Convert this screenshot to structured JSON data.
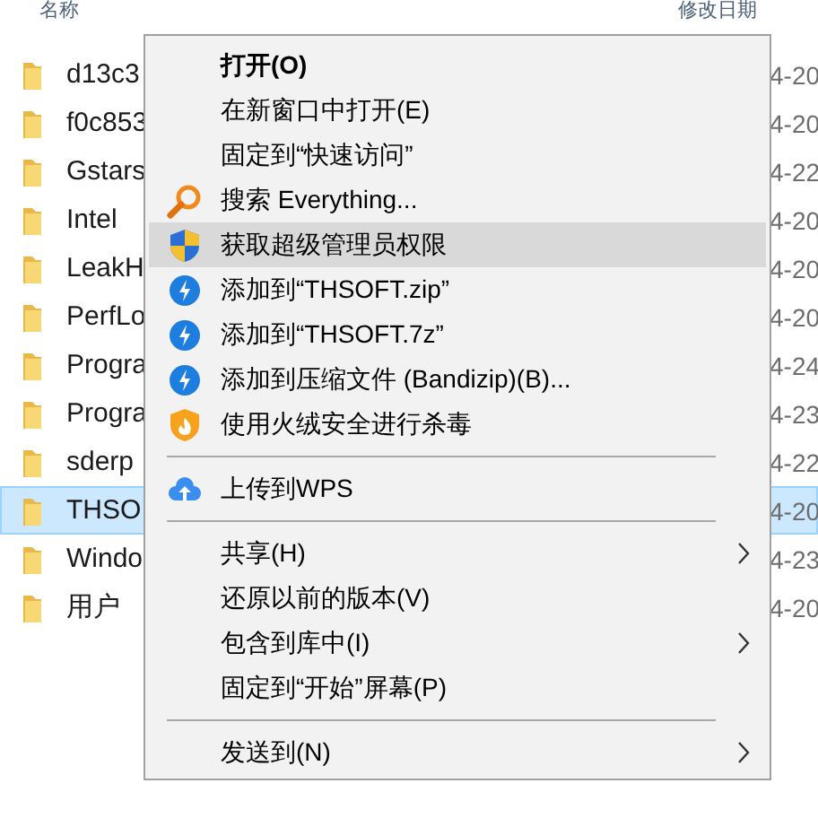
{
  "header": {
    "columns": [
      "名称",
      "修改日期"
    ]
  },
  "files": [
    {
      "name": "d13c3",
      "date": "4-20",
      "selected": false
    },
    {
      "name": "f0c853",
      "date": "4-20",
      "selected": false
    },
    {
      "name": "Gstars",
      "date": "4-22",
      "selected": false
    },
    {
      "name": "Intel",
      "date": "4-20",
      "selected": false
    },
    {
      "name": "LeakH",
      "date": "4-20",
      "selected": false
    },
    {
      "name": "PerfLo",
      "date": "4-20",
      "selected": false
    },
    {
      "name": "Progra",
      "date": "4-24",
      "selected": false
    },
    {
      "name": "Progra",
      "date": "4-23",
      "selected": false
    },
    {
      "name": "sderp",
      "date": "4-22",
      "selected": false
    },
    {
      "name": "THSO",
      "date": "4-20",
      "selected": true
    },
    {
      "name": "Windo",
      "date": "4-23",
      "selected": false
    },
    {
      "name": "用户",
      "date": "4-20",
      "selected": false
    }
  ],
  "context_menu": {
    "items": [
      {
        "kind": "text",
        "label": "打开(O)",
        "default": true,
        "submenu": false,
        "selected": false
      },
      {
        "kind": "text",
        "label": "在新窗口中打开(E)",
        "default": false,
        "submenu": false,
        "selected": false
      },
      {
        "kind": "text",
        "label": "固定到“快速访问”",
        "default": false,
        "submenu": false,
        "selected": false
      },
      {
        "kind": "magnifier",
        "label": "搜索 Everything...",
        "default": false,
        "submenu": false,
        "selected": false
      },
      {
        "kind": "shield",
        "label": "获取超级管理员权限",
        "default": false,
        "submenu": false,
        "selected": true
      },
      {
        "kind": "lightning",
        "label": "添加到“THSOFT.zip”",
        "default": false,
        "submenu": false,
        "selected": false
      },
      {
        "kind": "lightning",
        "label": "添加到“THSOFT.7z”",
        "default": false,
        "submenu": false,
        "selected": false
      },
      {
        "kind": "lightning",
        "label": "添加到压缩文件 (Bandizip)(B)...",
        "default": false,
        "submenu": false,
        "selected": false
      },
      {
        "kind": "flame",
        "label": "使用火绒安全进行杀毒",
        "default": false,
        "submenu": false,
        "selected": false
      },
      {
        "kind": "separator"
      },
      {
        "kind": "cloud",
        "label": "上传到WPS",
        "default": false,
        "submenu": false,
        "selected": false
      },
      {
        "kind": "separator"
      },
      {
        "kind": "text",
        "label": "共享(H)",
        "default": false,
        "submenu": true,
        "selected": false
      },
      {
        "kind": "text",
        "label": "还原以前的版本(V)",
        "default": false,
        "submenu": false,
        "selected": false
      },
      {
        "kind": "text",
        "label": "包含到库中(I)",
        "default": false,
        "submenu": true,
        "selected": false
      },
      {
        "kind": "text",
        "label": "固定到“开始”屏幕(P)",
        "default": false,
        "submenu": false,
        "selected": false
      },
      {
        "kind": "separator"
      },
      {
        "kind": "text",
        "label": "发送到(N)",
        "default": false,
        "submenu": true,
        "selected": false
      }
    ]
  }
}
